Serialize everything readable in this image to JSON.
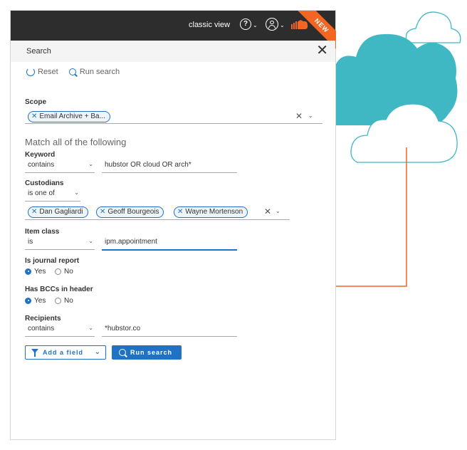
{
  "topbar": {
    "view_label": "classic view",
    "help_glyph": "?",
    "badge": "NEW"
  },
  "header": {
    "title": "Search"
  },
  "toolbar": {
    "reset_label": "Reset",
    "run_label": "Run search"
  },
  "scope": {
    "label": "Scope",
    "chips": [
      "Email Archive + Ba..."
    ]
  },
  "match_heading": "Match all of the following",
  "keyword": {
    "label": "Keyword",
    "operator": "contains",
    "value": "hubstor OR cloud OR arch*"
  },
  "custodians": {
    "label": "Custodians",
    "operator": "is one of",
    "chips": [
      "Dan Gagliardi",
      "Geoff Bourgeois",
      "Wayne Mortenson"
    ]
  },
  "item_class": {
    "label": "Item class",
    "operator": "is",
    "value": "ipm.appointment"
  },
  "journal_report": {
    "label": "Is journal report",
    "yes": "Yes",
    "no": "No",
    "selected": "Yes"
  },
  "bcc_header": {
    "label": "Has BCCs in header",
    "yes": "Yes",
    "no": "No",
    "selected": "Yes"
  },
  "recipients": {
    "label": "Recipients",
    "operator": "contains",
    "value": "*hubstor.co"
  },
  "buttons": {
    "add_field": "Add a field",
    "run_search": "Run search"
  },
  "colors": {
    "accent": "#1f72c4",
    "brand": "#f26522",
    "topbar": "#2d2d2d",
    "cloud_teal": "#3fb8c3"
  }
}
